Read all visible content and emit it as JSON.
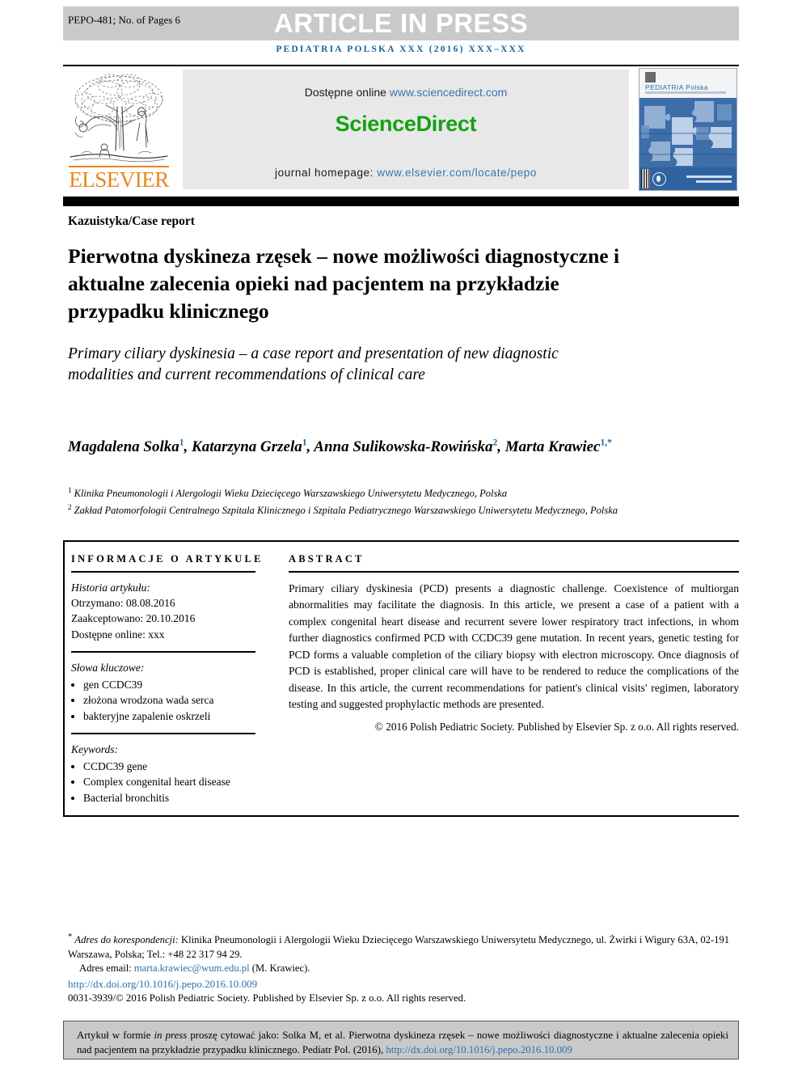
{
  "header": {
    "manuscript_id": "PEPO-481; No. of Pages 6",
    "banner_text": "ARTICLE IN PRESS",
    "running_head": "PEDIATRIA POLSKA XXX (2016) XXX–XXX",
    "banner_bg": "#c9c9c9",
    "running_head_color": "#1a6496"
  },
  "masthead": {
    "elsevier_wordmark": "ELSEVIER",
    "elsevier_color": "#e8871e",
    "available_online_label": "Dostępne online",
    "sciencedirect_url": "www.sciencedirect.com",
    "sciencedirect_brand": "ScienceDirect",
    "sciencedirect_color": "#16a016",
    "journal_homepage_label": "journal homepage:",
    "journal_homepage_url": "www.elsevier.com/locate/pepo",
    "link_color": "#3a76af",
    "cover": {
      "journal_title": "PEDIATRIA Polska",
      "title_color": "#2a6ba8"
    }
  },
  "article": {
    "section_type": "Kazuistyka/Case report",
    "title_pl": "Pierwotna dyskineza rzęsek – nowe możliwości diagnostyczne i aktualne zalecenia opieki nad pacjentem na przykładzie przypadku klinicznego",
    "title_en": "Primary ciliary dyskinesia – a case report and presentation of new diagnostic modalities and current recommendations of clinical care",
    "authors": [
      {
        "name": "Magdalena Solka",
        "sup": "1",
        "sep": ", "
      },
      {
        "name": "Katarzyna Grzela",
        "sup": "1",
        "sep": ", "
      },
      {
        "name": "Anna Sulikowska-Rowińska",
        "sup": "2",
        "sep": ", "
      },
      {
        "name": "Marta Krawiec",
        "sup": "1,*",
        "sep": ""
      }
    ],
    "affiliations": [
      {
        "marker": "1",
        "text": "Klinika Pneumonologii i Alergologii Wieku Dziecięcego Warszawskiego Uniwersytetu Medycznego, Polska"
      },
      {
        "marker": "2",
        "text": "Zakład Patomorfologii Centralnego Szpitala Klinicznego i Szpitala Pediatrycznego Warszawskiego Uniwersytetu Medycznego, Polska"
      }
    ]
  },
  "info_column": {
    "heading": "INFORMACJE O ARTYKULE",
    "history_label": "Historia artykułu:",
    "history": [
      "Otrzymano: 08.08.2016",
      "Zaakceptowano: 20.10.2016",
      "Dostępne online: xxx"
    ],
    "keywords_pl_label": "Słowa kluczowe:",
    "keywords_pl": [
      "gen CCDC39",
      "złożona wrodzona wada serca",
      "bakteryjne zapalenie oskrzeli"
    ],
    "keywords_en_label": "Keywords:",
    "keywords_en": [
      "CCDC39 gene",
      "Complex congenital heart disease",
      "Bacterial bronchitis"
    ]
  },
  "abstract": {
    "heading": "ABSTRACT",
    "body": "Primary ciliary dyskinesia (PCD) presents a diagnostic challenge. Coexistence of multiorgan abnormalities may facilitate the diagnosis. In this article, we present a case of a patient with a complex congenital heart disease and recurrent severe lower respiratory tract infections, in whom further diagnostics confirmed PCD with CCDC39 gene mutation. In recent years, genetic testing for PCD forms a valuable completion of the ciliary biopsy with electron microscopy. Once diagnosis of PCD is established, proper clinical care will have to be rendered to reduce the complications of the disease. In this article, the current recommendations for patient's clinical visits' regimen, laboratory testing and suggested prophylactic methods are presented.",
    "copyright": "© 2016 Polish Pediatric Society. Published by Elsevier Sp. z o.o. All rights reserved."
  },
  "footnotes": {
    "correspondence_marker": "*",
    "correspondence_label": "Adres do korespondencji:",
    "correspondence_address": "Klinika Pneumonologii i Alergologii Wieku Dziecięcego Warszawskiego Uniwersytetu Medycznego, ul. Żwirki i Wigury 63A, 02-191 Warszawa, Polska; Tel.: +48 22 317 94 29.",
    "email_label": "Adres email:",
    "email": "marta.krawiec@wum.edu.pl",
    "email_owner": "(M. Krawiec).",
    "doi": "http://dx.doi.org/10.1016/j.pepo.2016.10.009",
    "issn_line": "0031-3939/© 2016 Polish Pediatric Society. Published by Elsevier Sp. z o.o. All rights reserved.",
    "link_color": "#2a71ab"
  },
  "citation_box": {
    "prefix": "Artykuł w formie",
    "italic": "in press",
    "middle": "proszę cytować jako: Solka M, et al. Pierwotna dyskineza rzęsek – nowe możliwości diagnostyczne i aktualne zalecenia opieki nad pacjentem na przykładzie przypadku klinicznego. Pediatr Pol. (2016),",
    "doi": "http://dx.doi.org/10.1016/j.pepo.2016.10.009",
    "bg": "#c9c9c9"
  }
}
